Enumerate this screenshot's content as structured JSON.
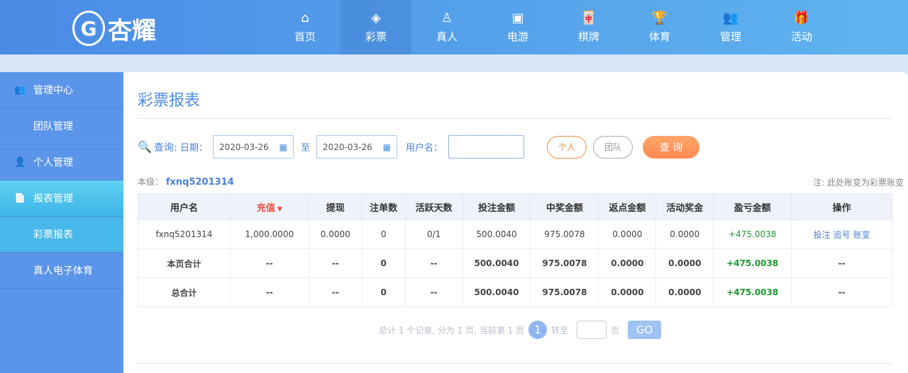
{
  "brand": {
    "logo_text": "杏耀"
  },
  "nav": [
    {
      "label": "首页",
      "icon": "⌂"
    },
    {
      "label": "彩票",
      "icon": "◈"
    },
    {
      "label": "真人",
      "icon": "♙"
    },
    {
      "label": "电游",
      "icon": "▣"
    },
    {
      "label": "棋牌",
      "icon": "🀄"
    },
    {
      "label": "体育",
      "icon": "🏆"
    },
    {
      "label": "管理",
      "icon": "👥"
    },
    {
      "label": "活动",
      "icon": "🎁"
    }
  ],
  "sidebar": {
    "items": [
      {
        "label": "管理中心",
        "icon": "👥"
      },
      {
        "label": "团队管理"
      },
      {
        "label": "个人管理",
        "icon": "👤"
      },
      {
        "label": "报表管理",
        "icon": "📄"
      },
      {
        "label": "彩票报表"
      },
      {
        "label": "真人电子体育"
      }
    ]
  },
  "page": {
    "title": "彩票报表"
  },
  "query": {
    "label": "查询:",
    "date_label": "日期：",
    "date_from": "2020-03-26",
    "to": "至",
    "date_to": "2020-03-26",
    "user_label": "用户名：",
    "user_value": "",
    "personal": "个人",
    "team": "团队",
    "search": "查 询"
  },
  "level": {
    "label": "本级：",
    "user": "fxnq5201314",
    "note": "注: 此处账变为彩票账变"
  },
  "table": {
    "headers": [
      "用户名",
      "充值",
      "提现",
      "注单数",
      "活跃天数",
      "投注金额",
      "中奖金额",
      "返点金额",
      "活动奖金",
      "盈亏金额",
      "操作"
    ],
    "rows": [
      [
        "fxnq5201314",
        "1,000.0000",
        "0.0000",
        "0",
        "0/1",
        "500.0040",
        "975.0078",
        "0.0000",
        "0.0000",
        "+475.0038"
      ],
      [
        "本页合计",
        "--",
        "--",
        "0",
        "--",
        "500.0040",
        "975.0078",
        "0.0000",
        "0.0000",
        "+475.0038",
        "--"
      ],
      [
        "总合计",
        "--",
        "--",
        "0",
        "--",
        "500.0040",
        "975.0078",
        "0.0000",
        "0.0000",
        "+475.0038",
        "--"
      ]
    ],
    "actions": [
      "投注",
      "追号",
      "账变"
    ]
  },
  "pagination": {
    "summary": "总计 1 个记录, 分为 1 页, 当前第 1 页",
    "current": "1",
    "goto": "转至",
    "page": "页",
    "go": "GO"
  }
}
